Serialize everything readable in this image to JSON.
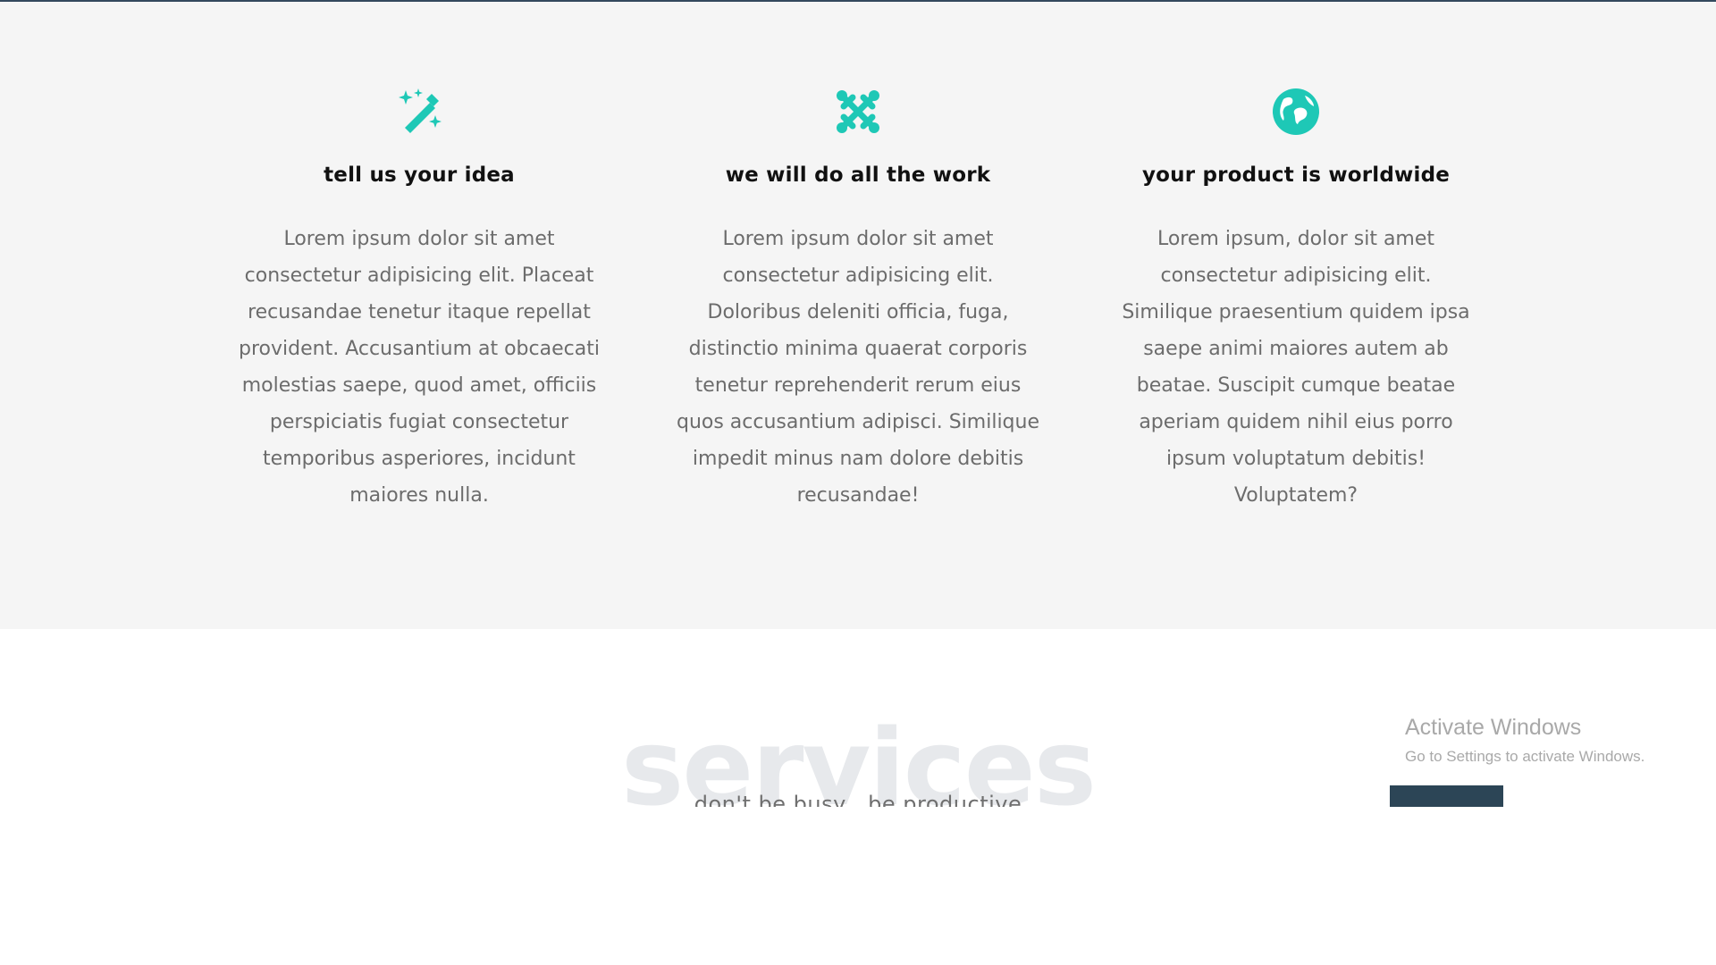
{
  "colors": {
    "accent": "#1ec8b6",
    "heading": "#111111",
    "body_text": "#6c6c6c",
    "section_bg": "#f5f5f5",
    "services_watermark": "#e7e9ec",
    "button": "#2c4556"
  },
  "features": [
    {
      "icon": "magic-wand-icon",
      "title": "tell us your idea",
      "text": "Lorem ipsum dolor sit amet consectetur adipisicing elit. Placeat recusandae tenetur itaque repellat provident. Accusantium at obcaecati molestias saepe, quod amet, officiis perspiciatis fugiat consectetur temporibus asperiores, incidunt maiores nulla."
    },
    {
      "icon": "joomla-icon",
      "title": "we will do all the work",
      "text": "Lorem ipsum dolor sit amet consectetur adipisicing elit. Doloribus deleniti officia, fuga, distinctio minima quaerat corporis tenetur reprehenderit rerum eius quos accusantium adipisci. Similique impedit minus nam dolore debitis recusandae!"
    },
    {
      "icon": "globe-icon",
      "title": "your product is worldwide",
      "text": "Lorem ipsum, dolor sit amet consectetur adipisicing elit. Similique praesentium quidem ipsa saepe animi maiores autem ab beatae. Suscipit cumque beatae aperiam quidem nihil eius porro ipsum voluptatum debitis! Voluptatem?"
    }
  ],
  "services": {
    "title": "services",
    "subtitle": "don't be busy , be productive"
  },
  "activation": {
    "title": "Activate Windows",
    "subtitle": "Go to Settings to activate Windows."
  }
}
